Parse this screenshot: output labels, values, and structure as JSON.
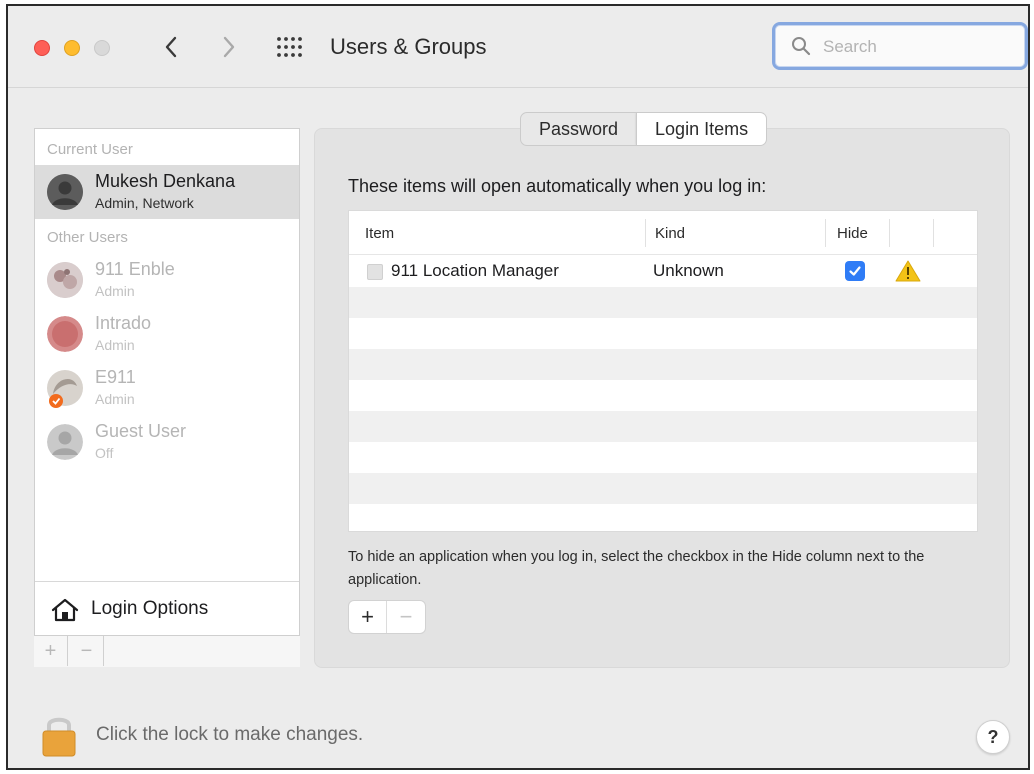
{
  "window": {
    "title": "Users & Groups",
    "search_placeholder": "Search"
  },
  "sidebar": {
    "current_user_label": "Current User",
    "other_users_label": "Other Users",
    "current_user": {
      "name": "Mukesh Denkana",
      "role": "Admin, Network"
    },
    "other_users": [
      {
        "name": "911 Enble",
        "role": "Admin"
      },
      {
        "name": "Intrado",
        "role": "Admin"
      },
      {
        "name": "E911",
        "role": "Admin"
      },
      {
        "name": "Guest User",
        "role": "Off"
      }
    ],
    "login_options_label": "Login Options",
    "add_label": "+",
    "remove_label": "−"
  },
  "tabs": [
    {
      "label": "Password",
      "active": false
    },
    {
      "label": "Login Items",
      "active": true
    }
  ],
  "login_items": {
    "heading": "These items will open automatically when you log in:",
    "columns": [
      "Item",
      "Kind",
      "Hide"
    ],
    "rows": [
      {
        "item": "911 Location Manager",
        "kind": "Unknown",
        "hide": true,
        "warning": true
      }
    ],
    "help_text": "To hide an application when you log in, select the checkbox in the Hide column next to the application.",
    "add_label": "+",
    "remove_label": "−"
  },
  "footer": {
    "lock_text": "Click the lock to make changes.",
    "help_label": "?"
  },
  "colors": {
    "accent": "#2f7cf6",
    "lock": "#e9a33b",
    "warning": "#f3c316"
  }
}
